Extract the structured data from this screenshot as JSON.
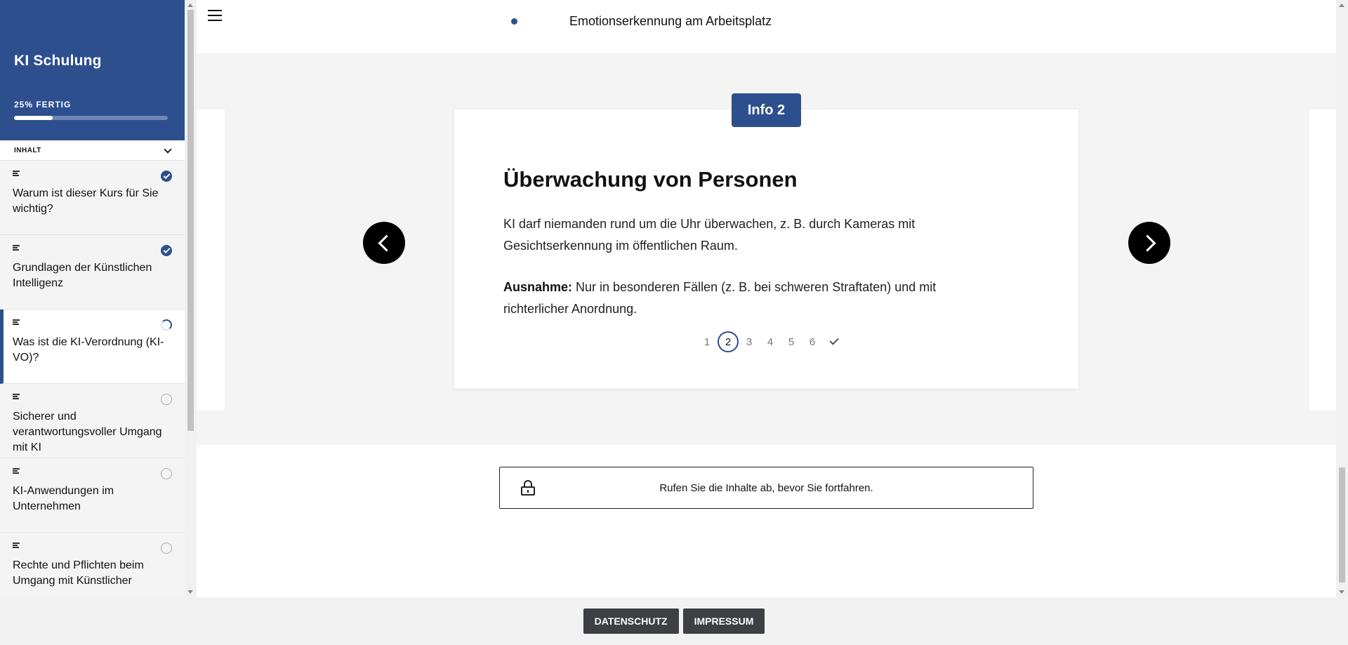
{
  "sidebar": {
    "course_title": "KI Schulung",
    "progress_label": "25% FERTIG",
    "progress_fraction": 0.25,
    "toc_heading": "INHALT",
    "items": [
      {
        "label": "Warum ist dieser Kurs für Sie wichtig?",
        "status": "done"
      },
      {
        "label": "Grundlagen der Künstlichen Intelligenz",
        "status": "done"
      },
      {
        "label": "Was ist die KI-Verordnung (KI-VO)?",
        "status": "in-progress"
      },
      {
        "label": "Sicherer und verantwortungsvoller Umgang mit KI",
        "status": "not-started"
      },
      {
        "label": "KI-Anwendungen im Unternehmen",
        "status": "not-started"
      },
      {
        "label": "Rechte und Pflichten beim Umgang mit Künstlicher",
        "status": "not-started"
      }
    ]
  },
  "topbar": {
    "bullet_text": "Emotionserkennung am Arbeitsplatz"
  },
  "card": {
    "badge": "Info 2",
    "title": "Überwachung von Personen",
    "paragraph1": "KI darf niemanden rund um die Uhr überwachen, z. B. durch Kameras mit Gesichtserkennung im öffentlichen Raum.",
    "paragraph2_bold": "Ausnahme:",
    "paragraph2_rest": " Nur in besonderen Fällen (z. B. bei schweren Straftaten) und mit richterlicher Anordnung.",
    "pages": [
      "1",
      "2",
      "3",
      "4",
      "5",
      "6"
    ],
    "current_page": "2"
  },
  "locked": {
    "text": "Rufen Sie die Inhalte ab, bevor Sie fortfahren."
  },
  "footer": {
    "privacy": "DATENSCHUTZ",
    "imprint": "IMPRESSUM"
  },
  "colors": {
    "brand": "#2d4f8e",
    "footer_button": "#3d3f42"
  }
}
